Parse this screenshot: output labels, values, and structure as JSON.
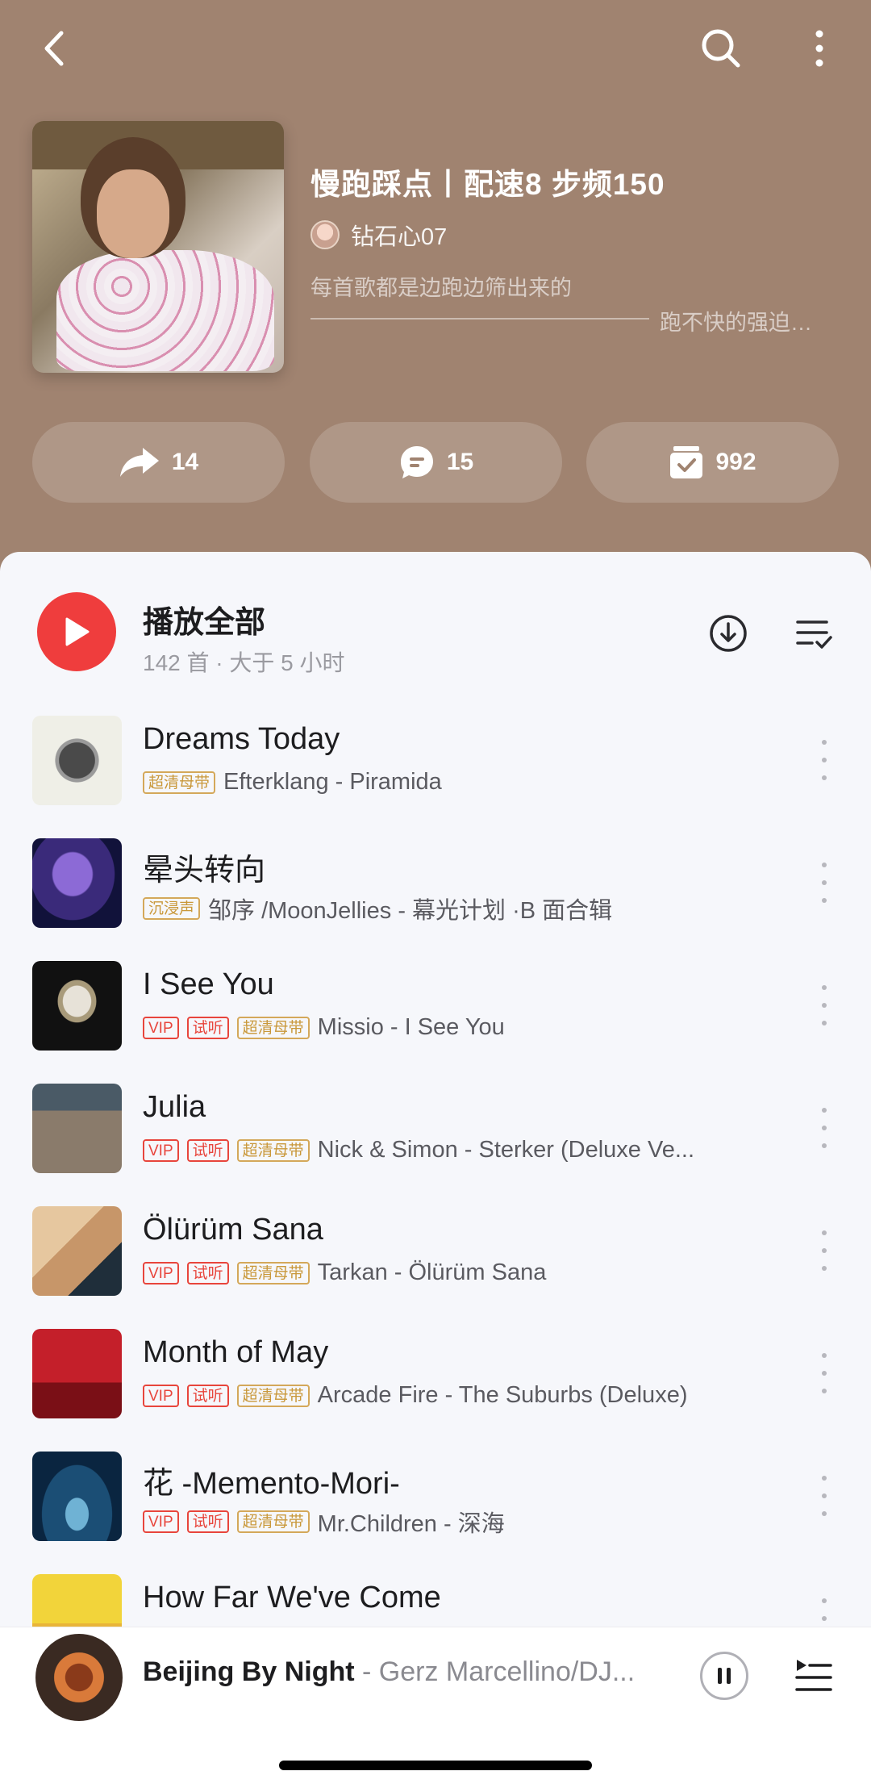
{
  "header": {
    "title": "慢跑踩点丨配速8 步频150",
    "creator": "钻石心07",
    "description_line1": "每首歌都是边跑边筛出来的",
    "description_line2": "跑不快的强迫…"
  },
  "stats": {
    "share": "14",
    "comment": "15",
    "collect": "992"
  },
  "play_all": {
    "label": "播放全部",
    "summary": "142 首 · 大于 5 小时"
  },
  "songs": [
    {
      "title": "Dreams Today",
      "tags": [
        "超清母带"
      ],
      "artist_album": "Efterklang - Piramida"
    },
    {
      "title": "晕头转向",
      "tags": [
        "沉浸声"
      ],
      "artist_album": "邹序 /MoonJellies - 幕光计划 ·B 面合辑"
    },
    {
      "title": "I See You",
      "tags": [
        "VIP",
        "试听",
        "超清母带"
      ],
      "artist_album": "Missio - I See You"
    },
    {
      "title": "Julia",
      "tags": [
        "VIP",
        "试听",
        "超清母带"
      ],
      "artist_album": "Nick & Simon - Sterker (Deluxe Ve..."
    },
    {
      "title": "Ölürüm Sana",
      "tags": [
        "VIP",
        "试听",
        "超清母带"
      ],
      "artist_album": "Tarkan - Ölürüm Sana"
    },
    {
      "title": "Month of May",
      "tags": [
        "VIP",
        "试听",
        "超清母带"
      ],
      "artist_album": "Arcade Fire - The Suburbs (Deluxe)"
    },
    {
      "title": "花 -Memento-Mori-",
      "tags": [
        "VIP",
        "试听",
        "超清母带"
      ],
      "artist_album": "Mr.Children - 深海"
    },
    {
      "title": "How Far We've Come",
      "tags": [],
      "artist_album": ""
    }
  ],
  "now_playing": {
    "song": "Beijing By Night",
    "separator": " - ",
    "artist": "Gerz Marcellino/DJ..."
  },
  "icons": {
    "back": "chevron-left-icon",
    "search": "search-icon",
    "more": "more-vertical-icon",
    "share": "share-arrow-icon",
    "comment": "comment-bubble-icon",
    "collect": "collect-box-icon",
    "download": "download-icon",
    "multi_select": "multi-select-icon",
    "pause": "pause-icon",
    "playlist": "playlist-icon"
  },
  "colors": {
    "header_bg": "#a08370",
    "accent_red": "#ef3d3d",
    "tag_gold": "#c9983a"
  }
}
